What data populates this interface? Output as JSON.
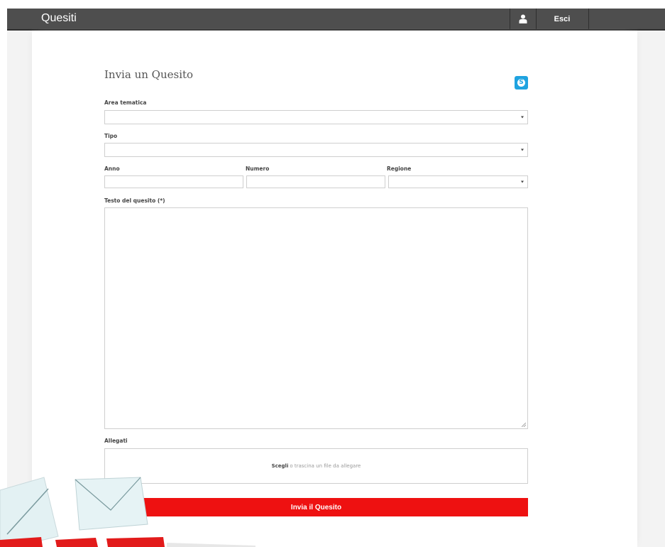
{
  "header": {
    "title": "Quesiti",
    "user_icon": "user-icon",
    "logout_label": "Esci"
  },
  "form": {
    "title": "Invia un Quesito",
    "skype_icon": "skype-icon",
    "skype_letter": "S",
    "fields": {
      "area": {
        "label": "Area tematica",
        "value": ""
      },
      "tipo": {
        "label": "Tipo",
        "value": ""
      },
      "anno": {
        "label": "Anno",
        "value": ""
      },
      "numero": {
        "label": "Numero",
        "value": ""
      },
      "regione": {
        "label": "Regione",
        "value": ""
      },
      "testo": {
        "label": "Testo del quesito (*)",
        "value": ""
      }
    },
    "attachments": {
      "label": "Allegati",
      "choose_label": "Scegli",
      "hint": "o trascina un file da allegare"
    },
    "submit_label": "Invia il Quesito"
  },
  "decoration": {
    "icons": [
      "envelope-icon",
      "envelope-icon"
    ],
    "colors": {
      "accent": "#ee1111",
      "topbar": "#4e4e4e",
      "skype": "#1fa3e0"
    }
  }
}
